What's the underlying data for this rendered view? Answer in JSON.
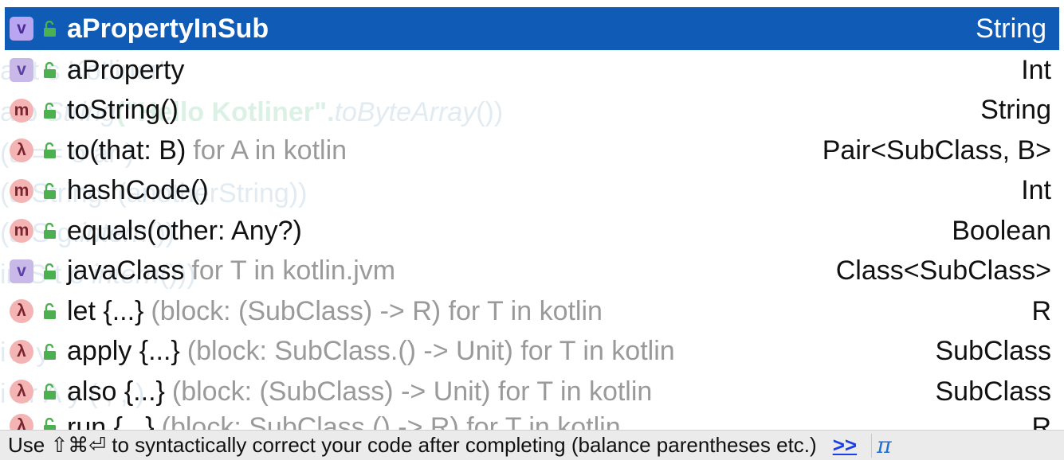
{
  "background_code": {
    "line1": "a      rt      s Kotliner\"",
    "line2_pre": "a   b  ",
    "line2_italic": "String",
    "line2_str": "(\"Hello Kotliner\".",
    "line2_italic2": "toByteArray",
    "line2_end": "())",
    "line3": "(a      ==     o  ar      )",
    "line4": "(a  String.   (anotherString))",
    "line5_pre": "(a  S      g.",
    "line5_italic": "intern",
    "line5_end": "())",
    "line6_pre": "in  S       t    o   ",
    "line6_italic": "intern",
    "line6_end": "()))",
    "line7": "i     A      y         ",
    "line8": "i     ar   A      y  ( , , )"
  },
  "completion": {
    "items": [
      {
        "badge": "v",
        "kind": "property",
        "name": "aPropertyInSub",
        "tail": "",
        "type": "String",
        "selected": true
      },
      {
        "badge": "v",
        "kind": "property",
        "name": "aProperty",
        "tail": "",
        "type": "Int",
        "selected": false
      },
      {
        "badge": "m",
        "kind": "method",
        "name": "toString()",
        "tail": "",
        "type": "String",
        "selected": false
      },
      {
        "badge": "λ",
        "kind": "extension",
        "name": "to(that: B)",
        "tail": "for A in kotlin",
        "type": "Pair<SubClass, B>",
        "selected": false
      },
      {
        "badge": "m",
        "kind": "method",
        "name": "hashCode()",
        "tail": "",
        "type": "Int",
        "selected": false
      },
      {
        "badge": "m",
        "kind": "method",
        "name": "equals(other: Any?)",
        "tail": "",
        "type": "Boolean",
        "selected": false
      },
      {
        "badge": "v",
        "kind": "property",
        "name": "javaClass",
        "tail": "for T in kotlin.jvm",
        "type": "Class<SubClass>",
        "selected": false
      },
      {
        "badge": "λ",
        "kind": "extension",
        "name": "let {...}",
        "tail": "(block: (SubClass) -> R) for T in kotlin",
        "type": "R",
        "selected": false
      },
      {
        "badge": "λ",
        "kind": "extension",
        "name": "apply {...}",
        "tail": "(block: SubClass.() -> Unit) for T in kotlin",
        "type": "SubClass",
        "selected": false
      },
      {
        "badge": "λ",
        "kind": "extension",
        "name": "also {...}",
        "tail": "(block: (SubClass) -> Unit) for T in kotlin",
        "type": "SubClass",
        "selected": false
      },
      {
        "badge": "λ",
        "kind": "extension",
        "name": "run {...}",
        "tail": "(block: SubClass.() -> R) for T in kotlin",
        "type": "R",
        "selected": false
      }
    ]
  },
  "footer": {
    "hint": "Use ⇧⌘⏎ to syntactically correct your code after completing (balance parentheses etc.)",
    "more_link": ">>",
    "pi_symbol": "π"
  },
  "colors": {
    "selection": "#0f5bb5",
    "property_badge": "#c8b9e8",
    "method_badge": "#f4b4b4",
    "public_icon": "#4caf50",
    "footer_bg": "#ebebeb",
    "link": "#1a3fe8"
  },
  "icons": {
    "property": "property-badge-icon",
    "method": "method-badge-icon",
    "extension": "lambda-badge-icon",
    "visibility": "public-visibility-icon"
  }
}
